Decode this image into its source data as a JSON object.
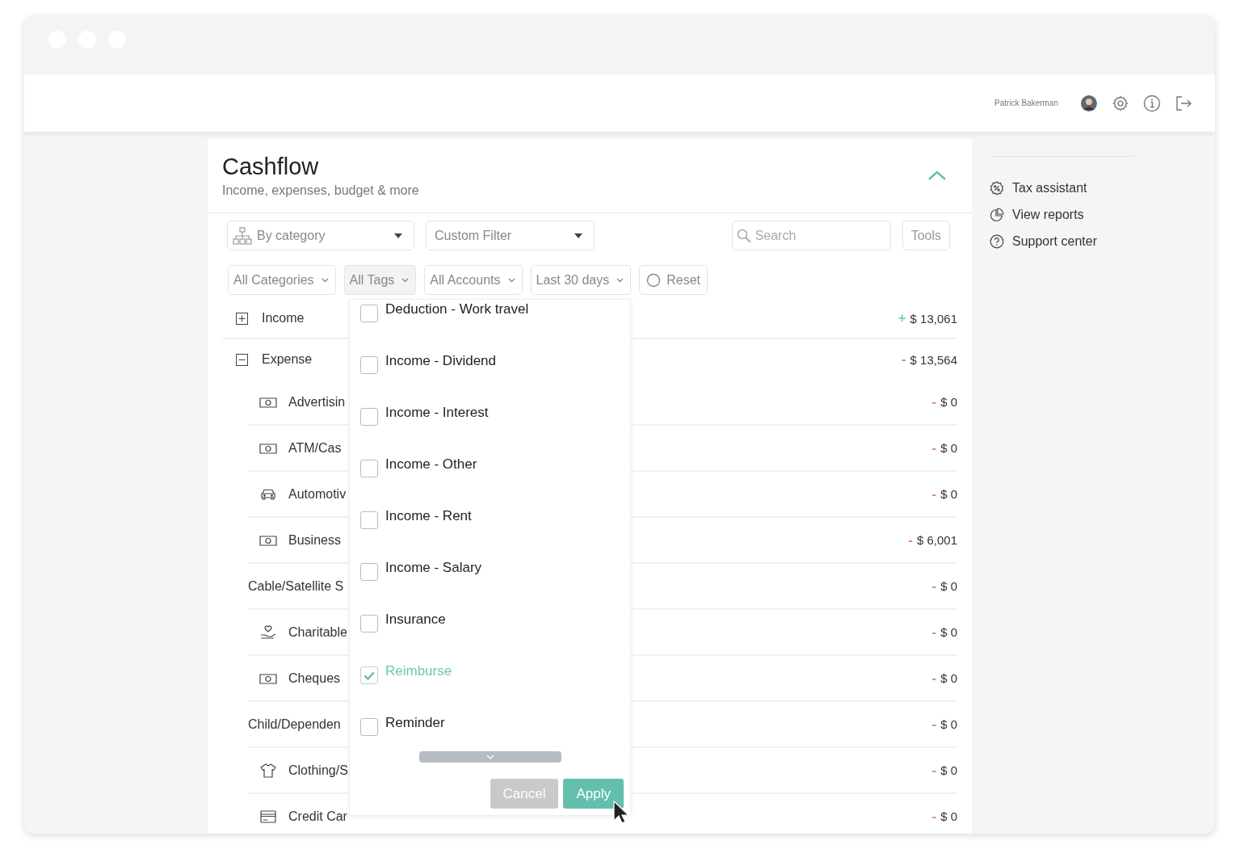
{
  "header": {
    "user_name": "Patrick Bakerman"
  },
  "card": {
    "title": "Cashflow",
    "subtitle": "Income, expenses, budget & more",
    "expanded": true
  },
  "toolbar": {
    "group_by": "By category",
    "custom_filter": "Custom Filter",
    "search": {
      "placeholder": "Search"
    },
    "tools": "Tools"
  },
  "filters": [
    {
      "label": "All Categories",
      "selected": false
    },
    {
      "label": "All Tags",
      "selected": true
    },
    {
      "label": "All Accounts",
      "selected": false
    },
    {
      "label": "Last 30 days",
      "selected": false
    }
  ],
  "reset": "Reset",
  "rows": [
    {
      "kind": "group",
      "label": "Income",
      "expanded": false,
      "color": "#7ccfbf",
      "sign": "+",
      "amount": "$ 13,061"
    },
    {
      "kind": "group",
      "label": "Expense",
      "expanded": true,
      "color": "#e0848f",
      "sign": "-",
      "amount": "$ 13,564"
    },
    {
      "kind": "cash",
      "label": "Advertisin",
      "color": "#e0848f",
      "sign": "-",
      "amount": "$ 0"
    },
    {
      "kind": "cash",
      "label": "ATM/Cas",
      "color": "#e0848f",
      "sign": "-",
      "amount": "$ 0"
    },
    {
      "kind": "car",
      "label": "Automotiv",
      "color": "#e0848f",
      "sign": "-",
      "amount": "$ 0"
    },
    {
      "kind": "cash",
      "label": "Business",
      "color": "#e0848f",
      "sign": "-",
      "amount": "$ 6,001"
    },
    {
      "kind": "plain",
      "label": "Cable/Satellite S",
      "color": "#e0848f",
      "sign": "-",
      "amount": "$ 0"
    },
    {
      "kind": "charity",
      "label": "Charitable",
      "color": "#e0848f",
      "sign": "-",
      "amount": "$ 0"
    },
    {
      "kind": "cash",
      "label": "Cheques",
      "color": "#e0848f",
      "sign": "-",
      "amount": "$ 0"
    },
    {
      "kind": "plain",
      "label": "Child/Dependen",
      "color": "#e0848f",
      "sign": "-",
      "amount": "$ 0"
    },
    {
      "kind": "shirt",
      "label": "Clothing/S",
      "color": "#e0848f",
      "sign": "-",
      "amount": "$ 0"
    },
    {
      "kind": "card",
      "label": "Credit Car",
      "color": "#e0848f",
      "sign": "-",
      "amount": "$ 0"
    }
  ],
  "tag_menu": {
    "items": [
      {
        "label": "Deduction - Work travel",
        "checked": false
      },
      {
        "label": "Income - Dividend",
        "checked": false
      },
      {
        "label": "Income - Interest",
        "checked": false
      },
      {
        "label": "Income - Other",
        "checked": false
      },
      {
        "label": "Income - Rent",
        "checked": false
      },
      {
        "label": "Income - Salary",
        "checked": false
      },
      {
        "label": "Insurance",
        "checked": false
      },
      {
        "label": "Reimburse",
        "checked": true
      },
      {
        "label": "Reminder",
        "checked": false
      }
    ],
    "cancel": {
      "label": "Cancel",
      "disabled": true
    },
    "apply": "Apply"
  },
  "sidebar": {
    "items": [
      {
        "kind": "tax",
        "label": "Tax assistant"
      },
      {
        "kind": "reports",
        "label": "View reports"
      },
      {
        "kind": "support",
        "label": "Support center"
      }
    ]
  }
}
